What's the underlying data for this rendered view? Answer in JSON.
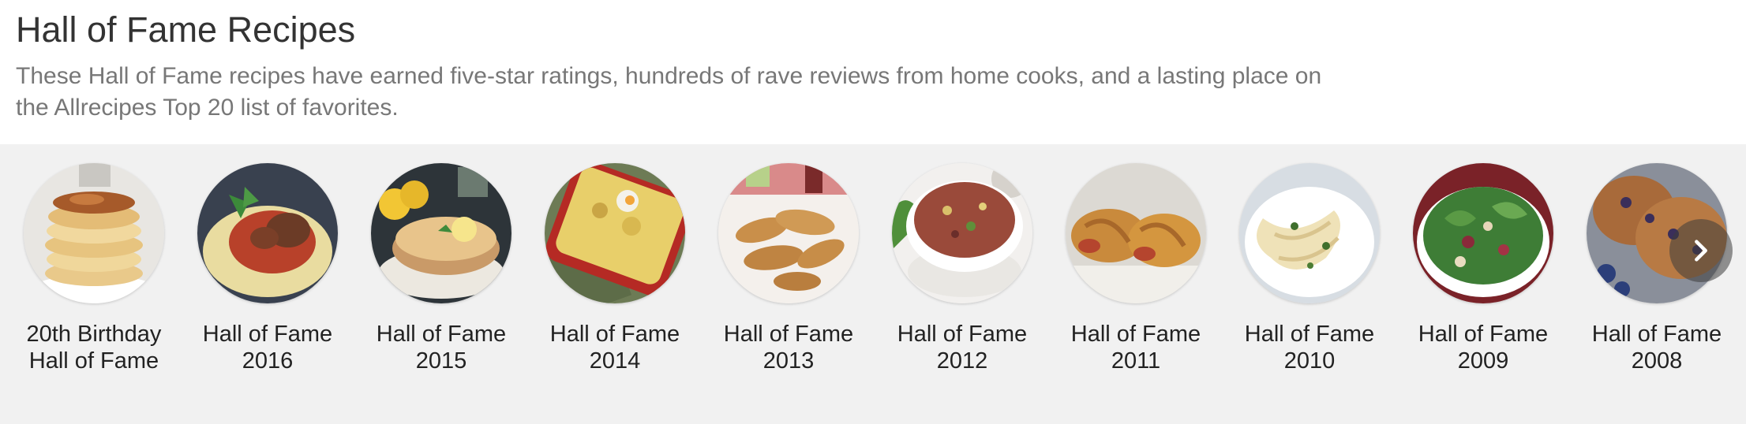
{
  "page": {
    "title": "Hall of Fame Recipes",
    "description": "These Hall of Fame recipes have earned five-star ratings, hundreds of rave reviews from home cooks, and a lasting place on the Allrecipes Top 20 list of favorites."
  },
  "carousel": {
    "items": [
      {
        "line1": "20th Birthday",
        "line2": "Hall of Fame",
        "icon": "pancakes"
      },
      {
        "line1": "Hall of Fame",
        "line2": "2016",
        "icon": "spaghetti"
      },
      {
        "line1": "Hall of Fame",
        "line2": "2015",
        "icon": "lemon-cake"
      },
      {
        "line1": "Hall of Fame",
        "line2": "2014",
        "icon": "casserole"
      },
      {
        "line1": "Hall of Fame",
        "line2": "2013",
        "icon": "chicken-tenders"
      },
      {
        "line1": "Hall of Fame",
        "line2": "2012",
        "icon": "quinoa-salad"
      },
      {
        "line1": "Hall of Fame",
        "line2": "2011",
        "icon": "pretzel-dogs"
      },
      {
        "line1": "Hall of Fame",
        "line2": "2010",
        "icon": "fettuccine"
      },
      {
        "line1": "Hall of Fame",
        "line2": "2009",
        "icon": "spinach-salad"
      },
      {
        "line1": "Hall of Fame",
        "line2": "2008",
        "icon": "muffins"
      }
    ],
    "next_icon": "chevron-right-icon"
  },
  "colors": {
    "carousel_bg": "#f1f1f1",
    "title": "#333333",
    "description": "#777777",
    "label": "#222222"
  }
}
